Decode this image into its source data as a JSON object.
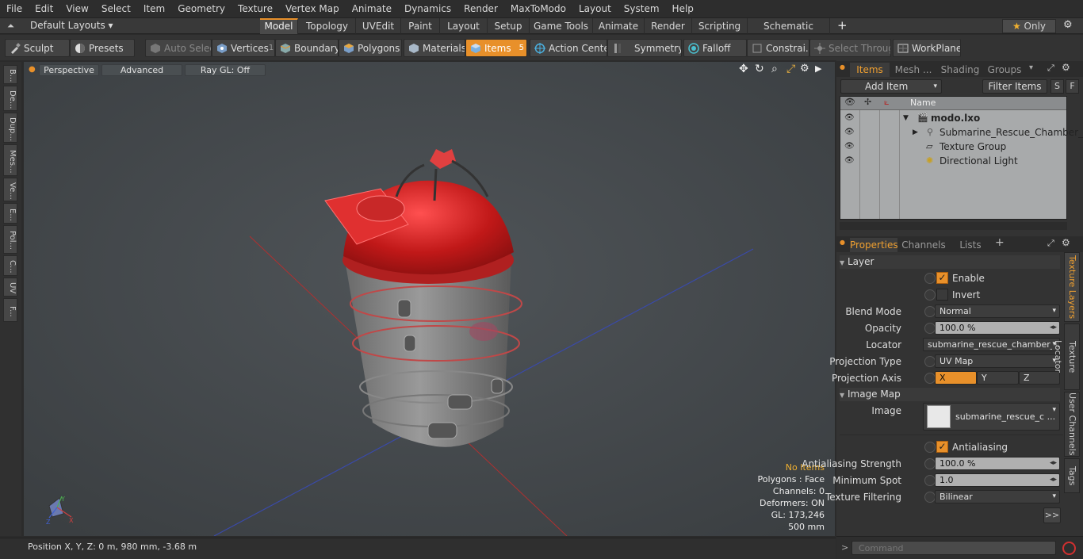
{
  "menu": [
    "File",
    "Edit",
    "View",
    "Select",
    "Item",
    "Geometry",
    "Texture",
    "Vertex Map",
    "Animate",
    "Dynamics",
    "Render",
    "MaxToModo",
    "Layout",
    "System",
    "Help"
  ],
  "layout_bar": {
    "layouts_label": "Default Layouts",
    "tabs": [
      "Model",
      "Topology",
      "UVEdit",
      "Paint",
      "Layout",
      "Setup",
      "Game Tools",
      "Animate",
      "Render",
      "Scripting",
      "Schematic Fusion"
    ],
    "active_tab": "Model",
    "add_symbol": "+",
    "only_label": "Only",
    "star": "★"
  },
  "toolbar": {
    "sculpt": "Sculpt",
    "presets": "Presets",
    "auto_select": "Auto Select",
    "vertices": "Vertices",
    "vertices_count": "1",
    "boundary": "Boundary",
    "polygons": "Polygons",
    "materials": "Materials",
    "items": "Items",
    "items_count": "5",
    "action_center": "Action Center",
    "symmetry": "Symmetry",
    "falloff": "Falloff",
    "constraints": "Constrai...",
    "select_through": "Select Through",
    "workplane": "WorkPlane"
  },
  "left_tabs": [
    "B...",
    "De...",
    "Dup...",
    "Mes...",
    "Ve...",
    "E...",
    "Pol...",
    "C...",
    "UV",
    "F..."
  ],
  "viewport": {
    "view_mode": "Perspective",
    "shading": "Advanced",
    "raygl": "Ray GL: Off",
    "stats": {
      "selection": "No Items",
      "polygons": "Polygons : Face",
      "channels": "Channels: 0",
      "deformers": "Deformers: ON",
      "gl": "GL: 173,246",
      "scale": "500 mm"
    },
    "axis_labels": {
      "y": "Y",
      "x": "X",
      "z": "Z"
    }
  },
  "status": {
    "position": "Position X, Y, Z:   0 m, 980 mm, -3.68 m"
  },
  "items_panel": {
    "tabs": [
      "Items",
      "Mesh ...",
      "Shading",
      "Groups"
    ],
    "active_tab": "Items",
    "add_item": "Add Item",
    "filter_items": "Filter Items",
    "s_btn": "S",
    "f_btn": "F",
    "col_name": "Name",
    "tree": [
      {
        "label": "modo.lxo",
        "bold": true
      },
      {
        "label": "Submarine_Rescue_Chamber_..."
      },
      {
        "label": "Texture Group"
      },
      {
        "label": "Directional Light"
      }
    ]
  },
  "properties_panel": {
    "tabs": [
      "Properties",
      "Channels",
      "Lists"
    ],
    "active_tab": "Properties",
    "add_symbol": "+",
    "section_layer": "Layer",
    "enable_label": "Enable",
    "enable_checked": true,
    "invert_label": "Invert",
    "invert_checked": false,
    "blend_mode_label": "Blend Mode",
    "blend_mode_value": "Normal",
    "opacity_label": "Opacity",
    "opacity_value": "100.0 %",
    "locator_label": "Locator",
    "locator_value": "submarine_rescue_chamber_i...",
    "projection_type_label": "Projection Type",
    "projection_type_value": "UV Map",
    "projection_axis_label": "Projection Axis",
    "projection_axis_options": [
      "X",
      "Y",
      "Z"
    ],
    "projection_axis_selected": "X",
    "section_image_map": "Image Map",
    "image_label": "Image",
    "image_value": "submarine_rescue_c ...",
    "antialiasing_label": "Antialiasing",
    "antialiasing_checked": true,
    "aa_strength_label": "Antialiasing Strength",
    "aa_strength_value": "100.0 %",
    "min_spot_label": "Minimum Spot",
    "min_spot_value": "1.0",
    "tex_filter_label": "Texture Filtering",
    "tex_filter_value": "Bilinear",
    "more_btn": ">>",
    "side_tabs": [
      "Texture Layers",
      "Texture Locator",
      "User Channels",
      "Tags"
    ],
    "active_side_tab": "Texture Layers"
  },
  "command": {
    "placeholder": "Command",
    "prompt": ">"
  },
  "colors": {
    "accent": "#e8902a",
    "viewport_bg": "#454a4e",
    "selection_red": "#e02020"
  }
}
